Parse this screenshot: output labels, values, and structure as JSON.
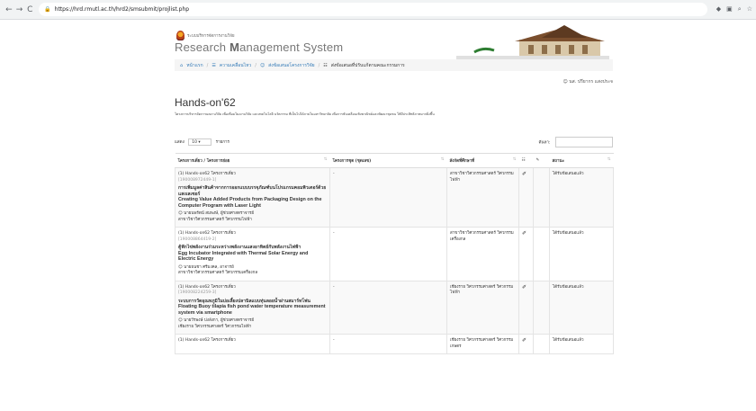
{
  "browser": {
    "url": "https://hrd.rmutl.ac.th/hrd2/smsubmit/projlist.php",
    "nav": [
      "←",
      "→",
      "C"
    ]
  },
  "header": {
    "org_small": "ระบบบริหารจัดการงานวิจัย",
    "title_prefix": "Research ",
    "title_bold": "M",
    "title_rest": "anagement System"
  },
  "breadcrumb": {
    "home": "หน้าแรก",
    "item2": "ความเคลื่อนไหว",
    "item3": "ส่งข้อเสนอโครงการวิจัย",
    "current": "ส่งข้อเสนอที่ปรับแก้ตามคณะกรรมการ"
  },
  "user": {
    "name": "นส. ปรียากร แสงประจ"
  },
  "main": {
    "heading": "Hands-on'62",
    "description": "โครงการบริหารจัดการผลงานวิจัย เพื่อเชื่อมโยงงานวิจัย และเทคโนโลยี นวัตกรรม ที่เป็นไปได้ภายในมหาวิทยาลัย เพื่อการขับเคลื่อนเชิงพาณิชย์และพัฒนาชุมชน ให้มีประสิทธิภาพมากยิ่งขึ้น"
  },
  "controls": {
    "show_label": "แสดง",
    "page_size": "10",
    "records_label": "รายการ",
    "search_label": "ค้นหา:"
  },
  "table": {
    "headers": [
      "โครงการเดี่ยว / โครงการย่อย",
      "โครงการชุด (ชุดเลข)",
      "สังกัดที่ศึกษาที่",
      "",
      "",
      "สถานะ"
    ],
    "rows": [
      {
        "type": "(1) Hands-on62 โครงการเดี่ยว",
        "code": "[190008972449-1]",
        "title_th": "การเพิ่มมูลค่าสินค้าจากการออกแบบบรรจุภัณฑ์บนโปรแกรมคอมพิวเตอร์ด้วยแสงเลเซอร์",
        "title_en": "Creating Value Added Products from Packaging Design on the Computer Program with Laser Light",
        "person": "นายนพรัตน์ สมพงษ์, ผู้ช่วยศาสตราจารย์",
        "person_dept": "สาขาวิชาวิศวกรรมศาสตร์ วิศวกรรมไฟฟ้า",
        "group": "-",
        "affiliation": "สาขาวิชาวิศวกรรมศาสตร์ วิศวกรรมไฟฟ้า",
        "status": "ได้รับข้อเสนอแล้ว"
      },
      {
        "type": "(1) Hands-on62 โครงการเดี่ยว",
        "code": "[190008864419-2]",
        "title_th": "ตู้ฟักไข่พลังงานร่วมระหว่างพลังงานแสงอาทิตย์กับพลังงานไฟฟ้า",
        "title_en": "Egg Incubator Integrated with Thermal Solar Energy and Electric Energy",
        "person": "นายธนชา ศรีมงคล, อาจารย์",
        "person_dept": "สาขาวิชาวิศวกรรมศาสตร์ วิศวกรรมเครื่องกล",
        "group": "-",
        "affiliation": "สาขาวิชาวิศวกรรมศาสตร์ วิศวกรรมเครื่องกล",
        "status": "ได้รับข้อเสนอแล้ว"
      },
      {
        "type": "(1) Hands-on62 โครงการเดี่ยว",
        "code": "[190008224259-3]",
        "title_th": "ระบบการวัดอุณหภูมิในบ่อเลี้ยงปลานิลแบบทุ่นลอยน้ำผ่านสมาร์ทโฟน",
        "title_en": "Floating Buoy tilapia fish pond water temperature measurement system via smartphone",
        "person": "นายวีรพงษ์ ปงลังกา, ผู้ช่วยศาสตราจารย์",
        "person_dept": "เชียงราย วิศวกรรมศาสตร์ วิศวกรรมไฟฟ้า",
        "group": "-",
        "affiliation": "เชียงราย วิศวกรรมศาสตร์ วิศวกรรมไฟฟ้า",
        "status": "ได้รับข้อเสนอแล้ว"
      },
      {
        "type": "(1) Hands-on62 โครงการเดี่ยว",
        "code": "",
        "title_th": "",
        "title_en": "",
        "person": "",
        "person_dept": "",
        "group": "-",
        "affiliation": "เชียงราย วิศวกรรมศาสตร์ วิศวกรรมเกษตร",
        "status": "ได้รับข้อเสนอแล้ว"
      }
    ]
  }
}
